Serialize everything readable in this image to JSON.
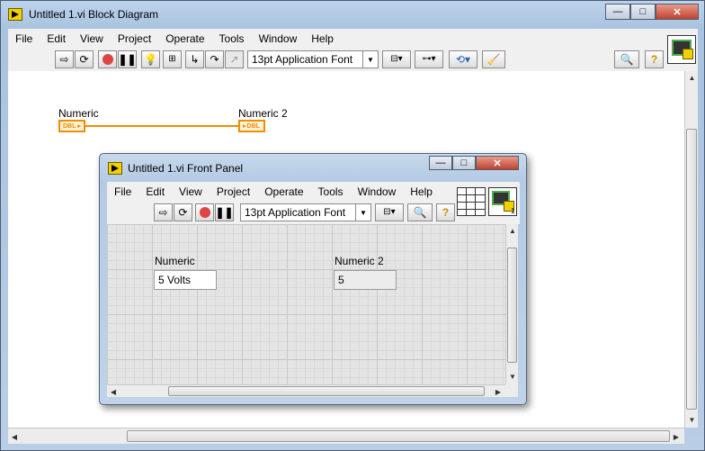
{
  "block_diagram": {
    "title": "Untitled 1.vi Block Diagram",
    "menu": [
      "File",
      "Edit",
      "View",
      "Project",
      "Operate",
      "Tools",
      "Window",
      "Help"
    ],
    "font": "13pt Application Font",
    "terminals": [
      {
        "label": "Numeric",
        "type": "DBL"
      },
      {
        "label": "Numeric 2",
        "type": "DBL"
      }
    ],
    "window_buttons": {
      "minimize": "—",
      "maximize": "□",
      "close": "✕"
    }
  },
  "front_panel": {
    "title": "Untitled 1.vi Front Panel",
    "menu": [
      "File",
      "Edit",
      "View",
      "Project",
      "Operate",
      "Tools",
      "Window",
      "Help"
    ],
    "font": "13pt Application Font",
    "controls": [
      {
        "label": "Numeric",
        "value": "5  Volts"
      },
      {
        "label": "Numeric 2",
        "value": "5"
      }
    ],
    "window_buttons": {
      "minimize": "—",
      "maximize": "□",
      "close": "✕"
    },
    "connector_number": "1"
  },
  "colors": {
    "wire": "#f08c00",
    "grid": "#e4e4e4"
  }
}
